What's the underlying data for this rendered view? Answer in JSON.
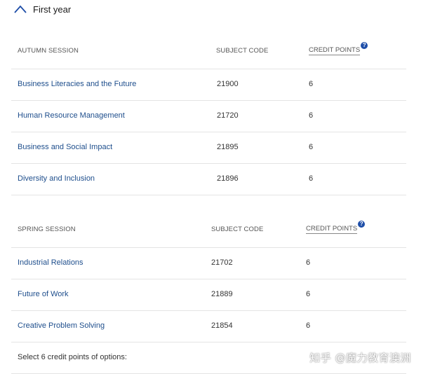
{
  "year_toggle": {
    "title": "First year",
    "icon": "chevron-up-icon"
  },
  "autumn": {
    "headers": {
      "session": "AUTUMN SESSION",
      "code": "SUBJECT CODE",
      "credits": "CREDIT POINTS",
      "help_icon": "?"
    },
    "rows": [
      {
        "name": "Business Literacies and the Future",
        "code": "21900",
        "credits": "6"
      },
      {
        "name": "Human Resource Management",
        "code": "21720",
        "credits": "6"
      },
      {
        "name": "Business and Social Impact",
        "code": "21895",
        "credits": "6"
      },
      {
        "name": "Diversity and Inclusion",
        "code": "21896",
        "credits": "6"
      }
    ]
  },
  "spring": {
    "headers": {
      "session": "SPRING SESSION",
      "code": "SUBJECT CODE",
      "credits": "CREDIT POINTS",
      "help_icon": "?"
    },
    "rows": [
      {
        "name": "Industrial Relations",
        "code": "21702",
        "credits": "6"
      },
      {
        "name": "Future of Work",
        "code": "21889",
        "credits": "6"
      },
      {
        "name": "Creative Problem Solving",
        "code": "21854",
        "credits": "6"
      }
    ],
    "options_text": "Select 6 credit points of options:"
  },
  "watermark": "知乎 @魔力教育澳洲",
  "colors": {
    "link": "#1e4e8c",
    "accent": "#1e4ea8",
    "divider": "#e4e4e4"
  }
}
